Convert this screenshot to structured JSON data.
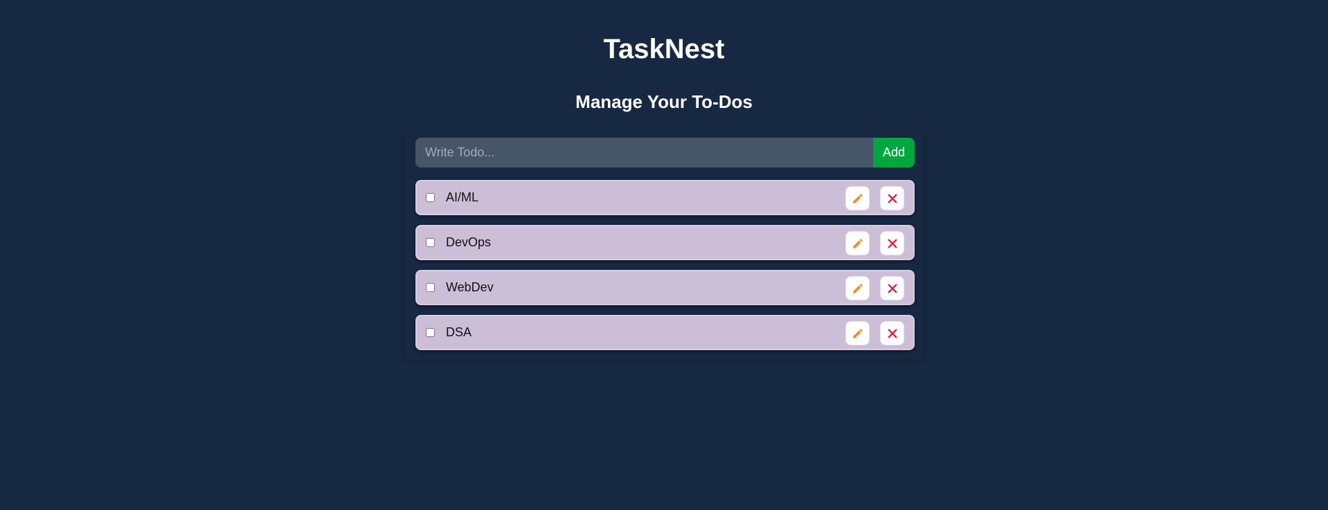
{
  "app": {
    "title": "TaskNest",
    "subtitle": "Manage Your To-Dos"
  },
  "form": {
    "input_placeholder": "Write Todo...",
    "input_value": "",
    "add_label": "Add"
  },
  "todos": [
    {
      "label": "AI/ML",
      "completed": false
    },
    {
      "label": "DevOps",
      "completed": false
    },
    {
      "label": "WebDev",
      "completed": false
    },
    {
      "label": "DSA",
      "completed": false
    }
  ],
  "icons": {
    "edit": "pencil-icon",
    "delete": "close-icon"
  },
  "colors": {
    "background": "#172842",
    "input_background": "#475569",
    "add_button": "#00a63e",
    "todo_item": "#ccbed7",
    "edit_icon": "#f28c28",
    "delete_icon": "#e11d48"
  }
}
